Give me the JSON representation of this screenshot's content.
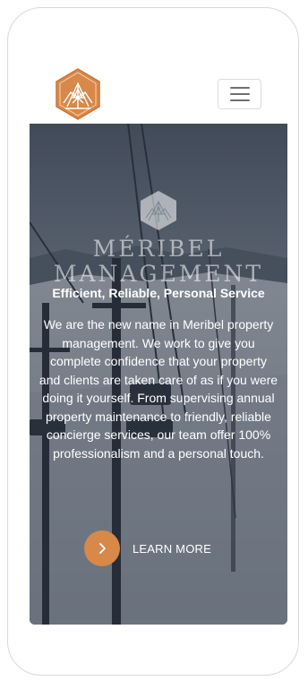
{
  "header": {
    "logo_icon": "meribel-mountain-emblem-icon",
    "menu_icon": "hamburger-menu-icon"
  },
  "hero": {
    "brand_line_1": "MÉRIBEL",
    "brand_line_2": "MANAGEMENT",
    "tagline": "Efficient, Reliable, Personal Service",
    "body": "We are the new name in Meribel property management. We work to give you complete confidence that your property and clients are taken care of as if you were doing it yourself. From supervising annual property maintenance to friendly, reliable concierge services, our team offer 100% professionalism and a personal touch.",
    "cta_label": "LEARN MORE",
    "cta_icon": "chevron-right-icon"
  },
  "colors": {
    "accent": "#d88848",
    "frame_border": "#d9d9d9"
  }
}
